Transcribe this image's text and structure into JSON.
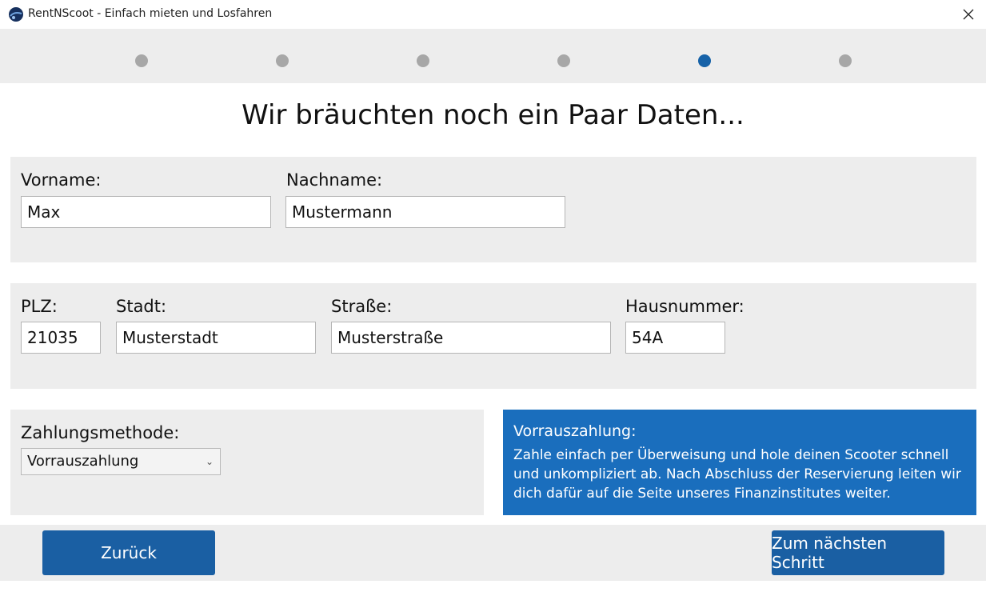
{
  "window": {
    "title": "RentNScoot - Einfach mieten und Losfahren",
    "icon": "scooter-globe-icon"
  },
  "stepper": {
    "total_steps": 6,
    "current_step": 5,
    "active_color": "#1662a8",
    "inactive_color": "#a7a7a7"
  },
  "heading": "Wir bräuchten noch ein Paar Daten...",
  "name_section": {
    "first_name_label": "Vorname:",
    "first_name_value": "Max",
    "last_name_label": "Nachname:",
    "last_name_value": "Mustermann"
  },
  "address_section": {
    "zip_label": "PLZ:",
    "zip_value": "21035",
    "city_label": "Stadt:",
    "city_value": "Musterstadt",
    "street_label": "Straße:",
    "street_value": "Musterstraße",
    "house_number_label": "Hausnummer:",
    "house_number_value": "54A"
  },
  "payment_section": {
    "label": "Zahlungsmethode:",
    "selected_method": "Vorrauszahlung"
  },
  "info_box": {
    "title": "Vorrauszahlung:",
    "text": "Zahle einfach per Überweisung und hole deinen Scooter schnell und unkompliziert ab. Nach Abschluss der Reservierung leiten wir dich dafür auf die Seite unseres Finanzinstitutes weiter.",
    "color": "#1a6ebd"
  },
  "footer": {
    "back_label": "Zurück",
    "next_label": "Zum nächsten Schritt",
    "button_color": "#1a5fa3"
  }
}
